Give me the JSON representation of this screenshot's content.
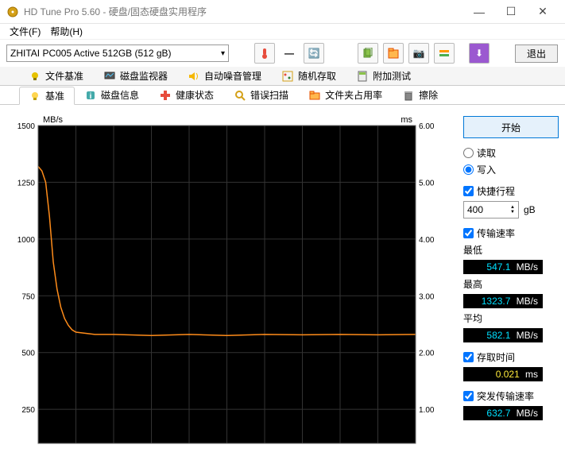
{
  "window": {
    "title": "HD Tune Pro 5.60 - 硬盘/固态硬盘实用程序"
  },
  "menu": {
    "file": "文件(F)",
    "help": "帮助(H)"
  },
  "toolbar": {
    "drive": "ZHITAI PC005 Active 512GB (512 gB)",
    "temp_dash": "—",
    "exit": "退出"
  },
  "tabs_row1": {
    "file_bench": "文件基准",
    "disk_monitor": "磁盘监视器",
    "aam": "自动噪音管理",
    "random": "随机存取",
    "extra": "附加测试"
  },
  "tabs_row2": {
    "benchmark": "基准",
    "disk_info": "磁盘信息",
    "health": "健康状态",
    "error_scan": "错误扫描",
    "folder_usage": "文件夹占用率",
    "erase": "擦除"
  },
  "side": {
    "start": "开始",
    "read": "读取",
    "write": "写入",
    "short_stroke": "快捷行程",
    "short_stroke_value": "400",
    "short_stroke_unit": "gB",
    "transfer_rate": "传输速率",
    "min": "最低",
    "min_value": "547.1",
    "max": "最高",
    "max_value": "1323.7",
    "avg": "平均",
    "avg_value": "582.1",
    "unit_mbs": "MB/s",
    "access_time": "存取时间",
    "access_value": "0.021",
    "access_unit": "ms",
    "burst": "突发传输速率",
    "burst_value": "632.7"
  },
  "chart": {
    "left_unit": "MB/s",
    "right_unit": "ms"
  },
  "chart_data": {
    "type": "line",
    "xlabel": "",
    "y_left_label": "MB/s",
    "y_right_label": "ms",
    "y_left_ticks": [
      250,
      500,
      750,
      1000,
      1250,
      1500
    ],
    "y_right_ticks": [
      1.0,
      2.0,
      3.0,
      4.0,
      5.0,
      6.0
    ],
    "ylim_left": [
      100,
      1500
    ],
    "ylim_right": [
      0.5,
      6.0
    ],
    "series": [
      {
        "name": "Transfer rate (MB/s)",
        "axis": "left",
        "x_percent": [
          0,
          1,
          2,
          3,
          4,
          5,
          6,
          7,
          8,
          9,
          10,
          15,
          20,
          30,
          40,
          50,
          60,
          70,
          80,
          90,
          100
        ],
        "values": [
          1320,
          1300,
          1250,
          1100,
          900,
          780,
          700,
          650,
          620,
          600,
          590,
          580,
          580,
          575,
          580,
          575,
          580,
          578,
          580,
          578,
          580
        ]
      }
    ]
  }
}
